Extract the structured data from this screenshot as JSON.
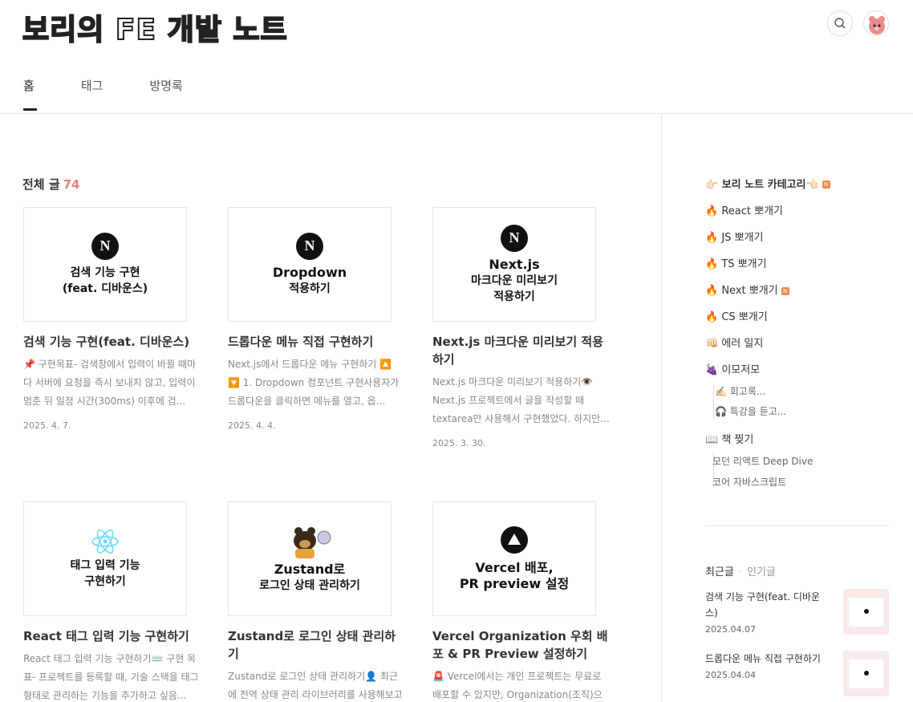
{
  "header": {
    "logo": "보리의 FE 개발 노트",
    "nav": [
      "홈",
      "태그",
      "방명록"
    ]
  },
  "main": {
    "total_label": "전체 글",
    "total_count": "74",
    "posts": [
      {
        "thumb_icon": "nextjs-logo",
        "thumb_lines": [
          "검색 기능 구현",
          "(feat. 디바운스)"
        ],
        "title": "검색 기능 구현(feat. 디바운스)",
        "excerpt": "📌 구현목표- 검색창에서 입력이 바뀔 때마다 서버에 요청을 즉시 보내지 않고, 입력이 멈춘 뒤 일정 시간(300ms) 이후에 검...",
        "date": "2025. 4. 7."
      },
      {
        "thumb_icon": "nextjs-logo",
        "thumb_lines": [
          "Dropdown",
          "적용하기"
        ],
        "title": "드롭다운 메뉴 직접 구현하기",
        "excerpt": "Next.js에서 드롭다운 메뉴 구현하기 🔼 🔽 1. Dropdown 컴포넌트 구현사용자가 드롭다운을 클릭하면 메뉴를 열고, 옵...",
        "date": "2025. 4. 4."
      },
      {
        "thumb_icon": "nextjs-logo",
        "thumb_lines": [
          "Next.js",
          "마크다운 미리보기",
          "적용하기"
        ],
        "title": "Next.js 마크다운 미리보기 적용하기",
        "excerpt": "Next.js 마크다운 미리보기 적용하기👁️ Next.js 프로젝트에서 글을 작성할 때 textarea만 사용해서 구현했었다. 하지만...",
        "date": "2025. 3. 30."
      },
      {
        "thumb_icon": "react-logo",
        "thumb_lines": [
          "태그 입력 기능",
          "구현하기"
        ],
        "title": "React 태그 입력 기능 구현하기",
        "excerpt": "React 태그 입력 기능 구현하기⌨️ 구현 목표- 프로젝트를 등록할 때, 기술 스택을 태그 형태로 관리하는 기능을 추가하고 싶음...",
        "date": ""
      },
      {
        "thumb_icon": "zustand-bear",
        "thumb_lines": [
          "Zustand로",
          "로그인 상태 관리하기"
        ],
        "title": "Zustand로 로그인 상태 관리하기",
        "excerpt": "Zustand로 로그인 상태 관리하기👤 최근에 전역 상태 관리 라이브러리를 사용해보고 싶다는 생각을 했다. 프로젝트가 커지...",
        "date": ""
      },
      {
        "thumb_icon": "vercel-logo",
        "thumb_lines": [
          "Vercel 배포,",
          "PR preview 설정"
        ],
        "title": "Vercel Organization 우회 배포 & PR Preview 설정하기",
        "excerpt": "🚨 Vercel에서는 개인 프로젝트는 무료로 배포할 수 있지만, Organization(조직)으",
        "date": ""
      }
    ]
  },
  "sidebar": {
    "category_title": "👉🏻 보리 노트 카테고리👈🏻",
    "categories": [
      {
        "label": "🔥 React 뽀개기",
        "new": false
      },
      {
        "label": "🔥 JS 뽀개기",
        "new": false
      },
      {
        "label": "🔥 TS 뽀개기",
        "new": false
      },
      {
        "label": "🔥 Next 뽀개기",
        "new": true
      },
      {
        "label": "🔥 CS 뽀개기",
        "new": false
      },
      {
        "label": "👊🏻 에러 일지",
        "new": false
      },
      {
        "label": "🍇 이모저모",
        "new": false
      }
    ],
    "sub_emo": [
      "✍🏻 회고록...",
      "🎧 특강을 듣고..."
    ],
    "book_label": "📖 책 찢기",
    "sub_book": [
      "모던 리액트 Deep Dive",
      "코어 자바스크립트"
    ],
    "tabs": {
      "recent": "최근글",
      "sep": "·",
      "popular": "인기글"
    },
    "recent_posts": [
      {
        "title": "검색 기능 구현(feat. 디바운스)",
        "date": "2025.04.07"
      },
      {
        "title": "드롭다운 메뉴 직접 구현하기",
        "date": "2025.04.04"
      }
    ],
    "new_badge": "N"
  },
  "colors": {
    "accent": "#e0857a",
    "new_badge": "#f08a4b",
    "text": "#333333",
    "muted": "#888888"
  }
}
